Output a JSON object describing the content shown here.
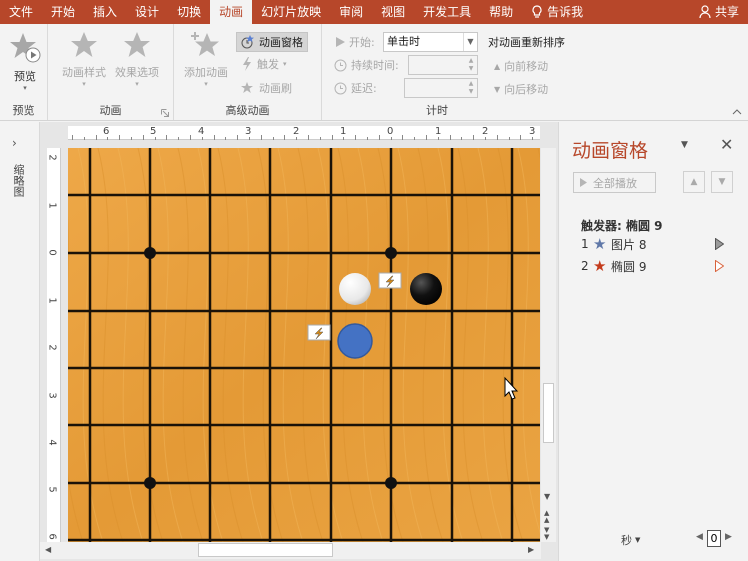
{
  "menu": {
    "items": [
      "文件",
      "开始",
      "插入",
      "设计",
      "切换",
      "动画",
      "幻灯片放映",
      "审阅",
      "视图",
      "开发工具",
      "帮助"
    ],
    "active_index": 5,
    "tell_me": "告诉我",
    "share": "共享"
  },
  "ribbon": {
    "preview": {
      "button": "预览",
      "group": "预览"
    },
    "animation": {
      "style": "动画样式",
      "effect": "效果选项",
      "group": "动画"
    },
    "advanced": {
      "add": "添加动画",
      "pane": "动画窗格",
      "trigger": "触发",
      "painter": "动画刷",
      "group": "高级动画"
    },
    "timing": {
      "start_label": "开始:",
      "start_value": "单击时",
      "duration_label": "持续时间:",
      "delay_label": "延迟:",
      "reorder_title": "对动画重新排序",
      "move_earlier": "向前移动",
      "move_later": "向后移动",
      "group": "计时"
    }
  },
  "left_panel": {
    "label": "缩略图"
  },
  "ruler": {
    "h": [
      "6",
      "5",
      "4",
      "3",
      "2",
      "1",
      "0",
      "1",
      "2",
      "3"
    ],
    "v": [
      "2",
      "1",
      "0",
      "1",
      "2",
      "3",
      "4",
      "5",
      "6"
    ]
  },
  "pane": {
    "title": "动画窗格",
    "play_all": "全部播放",
    "trigger_header": "触发器: 椭圆 9",
    "items": [
      {
        "num": "1",
        "name": "图片 8",
        "color": "#6078a8"
      },
      {
        "num": "2",
        "name": "椭圆 9",
        "color": "#c43b1c"
      }
    ],
    "seconds": "秒",
    "page_value": "0"
  },
  "colors": {
    "accent": "#b7472a",
    "board": "#e7a23d",
    "blue_stone": "#4472c4"
  }
}
